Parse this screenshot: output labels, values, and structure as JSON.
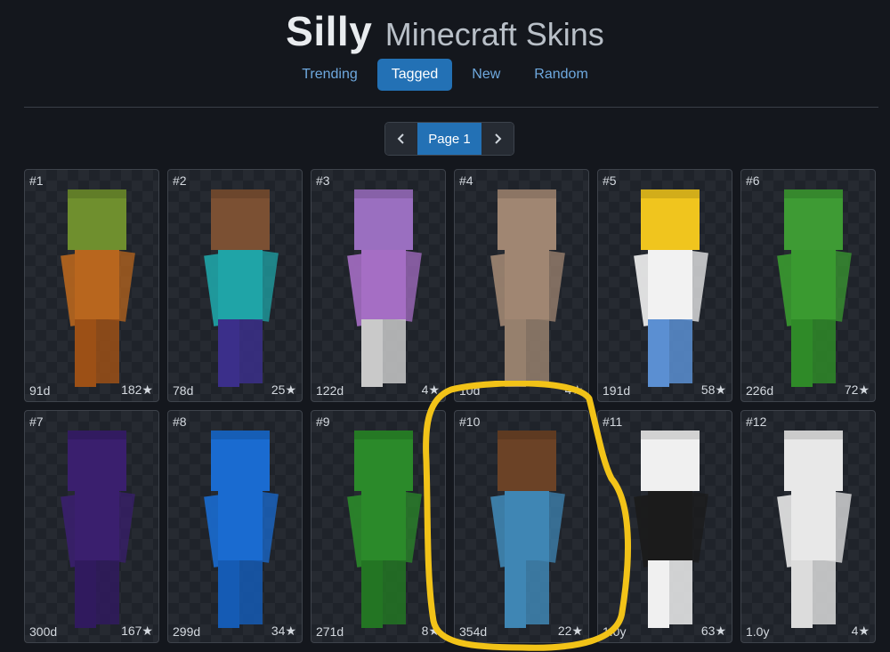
{
  "header": {
    "title_main": "Silly",
    "title_sub": "Minecraft Skins"
  },
  "tabs": [
    {
      "label": "Trending",
      "active": false
    },
    {
      "label": "Tagged",
      "active": true
    },
    {
      "label": "New",
      "active": false
    },
    {
      "label": "Random",
      "active": false
    }
  ],
  "pagination": {
    "prev_icon": "chevron-left-icon",
    "label": "Page 1",
    "next_icon": "chevron-right-icon"
  },
  "skins": [
    {
      "rank": "#1",
      "age": "91d",
      "stars": "182★",
      "colors": {
        "head": "#6f8f2e",
        "body": "#b8661e",
        "legs": "#9c5016"
      }
    },
    {
      "rank": "#2",
      "age": "78d",
      "stars": "25★",
      "colors": {
        "head": "#7b5033",
        "body": "#1fa4a7",
        "legs": "#3b2f8a"
      }
    },
    {
      "rank": "#3",
      "age": "122d",
      "stars": "4★",
      "colors": {
        "head": "#9a6fc0",
        "body": "#a56ec4",
        "legs": "#c9c9c9"
      }
    },
    {
      "rank": "#4",
      "age": "10d",
      "stars": "4★",
      "colors": {
        "head": "#a08672",
        "body": "#a08672",
        "legs": "#96806d"
      }
    },
    {
      "rank": "#5",
      "age": "191d",
      "stars": "58★",
      "colors": {
        "head": "#f0c51e",
        "body": "#f2f2f2",
        "legs": "#5b8fd2"
      }
    },
    {
      "rank": "#6",
      "age": "226d",
      "stars": "72★",
      "colors": {
        "head": "#3e9b34",
        "body": "#3a9a30",
        "legs": "#2f8a28"
      }
    },
    {
      "rank": "#7",
      "age": "300d",
      "stars": "167★",
      "colors": {
        "head": "#3a1f6e",
        "body": "#3a1f6e",
        "legs": "#301a5e"
      }
    },
    {
      "rank": "#8",
      "age": "299d",
      "stars": "34★",
      "colors": {
        "head": "#1a6bd0",
        "body": "#1a6bd0",
        "legs": "#155bb4"
      }
    },
    {
      "rank": "#9",
      "age": "271d",
      "stars": "8★",
      "colors": {
        "head": "#2b8a2a",
        "body": "#2b8a2a",
        "legs": "#237523"
      }
    },
    {
      "rank": "#10",
      "age": "354d",
      "stars": "22★",
      "colors": {
        "head": "#6b4226",
        "body": "#3f86b4",
        "legs": "#3f86b4"
      }
    },
    {
      "rank": "#11",
      "age": "1.0y",
      "stars": "63★",
      "colors": {
        "head": "#f0f0f0",
        "body": "#1b1b1b",
        "legs": "#f0f0f0"
      }
    },
    {
      "rank": "#12",
      "age": "1.0y",
      "stars": "4★",
      "colors": {
        "head": "#e8e8e8",
        "body": "#e8e8e8",
        "legs": "#dcdcdc"
      }
    }
  ],
  "highlight_color": "#f2c318"
}
